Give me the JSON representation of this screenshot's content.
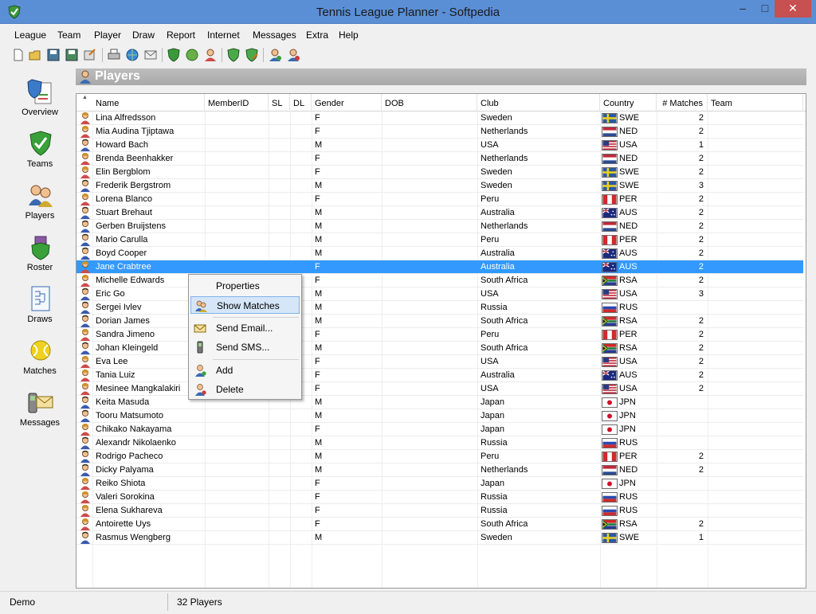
{
  "window": {
    "title": "Tennis League Planner - Softpedia"
  },
  "menu": [
    "League",
    "Team",
    "Player",
    "Draw",
    "Report",
    "Internet",
    "Messages",
    "Extra",
    "Help"
  ],
  "toolbar_icons": [
    "new-icon",
    "open-icon",
    "save-icon",
    "save-as-icon",
    "export-icon",
    "print-icon",
    "web-icon",
    "email-icon",
    "shield-check-icon",
    "globe-icon",
    "player-icon",
    "team-check-icon",
    "team-edit-icon",
    "add-player-icon",
    "delete-player-icon"
  ],
  "nav": [
    {
      "label": "Overview",
      "icon": "overview-icon"
    },
    {
      "label": "Teams",
      "icon": "teams-icon"
    },
    {
      "label": "Players",
      "icon": "players-icon"
    },
    {
      "label": "Roster",
      "icon": "roster-icon"
    },
    {
      "label": "Draws",
      "icon": "draws-icon"
    },
    {
      "label": "Matches",
      "icon": "matches-icon"
    },
    {
      "label": "Messages",
      "icon": "messages-icon"
    }
  ],
  "section": {
    "title": "Players"
  },
  "columns": [
    "Name",
    "MemberID",
    "SL",
    "DL",
    "Gender",
    "DOB",
    "Club",
    "Country",
    "# Matches",
    "Team"
  ],
  "selected_row": 11,
  "players": [
    {
      "name": "Lina Alfredsson",
      "gender": "F",
      "club": "Sweden",
      "country": "SWE",
      "matches": "2"
    },
    {
      "name": "Mia Audina Tjiptawa",
      "gender": "F",
      "club": "Netherlands",
      "country": "NED",
      "matches": "2"
    },
    {
      "name": "Howard Bach",
      "gender": "M",
      "club": "USA",
      "country": "USA",
      "matches": "1"
    },
    {
      "name": "Brenda Beenhakker",
      "gender": "F",
      "club": "Netherlands",
      "country": "NED",
      "matches": "2"
    },
    {
      "name": "Elin Bergblom",
      "gender": "F",
      "club": "Sweden",
      "country": "SWE",
      "matches": "2"
    },
    {
      "name": "Frederik Bergstrom",
      "gender": "M",
      "club": "Sweden",
      "country": "SWE",
      "matches": "3"
    },
    {
      "name": "Lorena Blanco",
      "gender": "F",
      "club": "Peru",
      "country": "PER",
      "matches": "2"
    },
    {
      "name": "Stuart Brehaut",
      "gender": "M",
      "club": "Australia",
      "country": "AUS",
      "matches": "2"
    },
    {
      "name": "Gerben Bruijstens",
      "gender": "M",
      "club": "Netherlands",
      "country": "NED",
      "matches": "2"
    },
    {
      "name": "Mario Carulla",
      "gender": "M",
      "club": "Peru",
      "country": "PER",
      "matches": "2"
    },
    {
      "name": "Boyd Cooper",
      "gender": "M",
      "club": "Australia",
      "country": "AUS",
      "matches": "2"
    },
    {
      "name": "Jane Crabtree",
      "gender": "F",
      "club": "Australia",
      "country": "AUS",
      "matches": "2"
    },
    {
      "name": "Michelle Edwards",
      "gender": "F",
      "club": "South Africa",
      "country": "RSA",
      "matches": "2"
    },
    {
      "name": "Eric Go",
      "gender": "M",
      "club": "USA",
      "country": "USA",
      "matches": "3"
    },
    {
      "name": "Sergei Ivlev",
      "gender": "M",
      "club": "Russia",
      "country": "RUS",
      "matches": ""
    },
    {
      "name": "Dorian James",
      "gender": "M",
      "club": "South Africa",
      "country": "RSA",
      "matches": "2"
    },
    {
      "name": "Sandra Jimeno",
      "gender": "F",
      "club": "Peru",
      "country": "PER",
      "matches": "2"
    },
    {
      "name": "Johan Kleingeld",
      "gender": "M",
      "club": "South Africa",
      "country": "RSA",
      "matches": "2"
    },
    {
      "name": "Eva Lee",
      "gender": "F",
      "club": "USA",
      "country": "USA",
      "matches": "2"
    },
    {
      "name": "Tania Luiz",
      "gender": "F",
      "club": "Australia",
      "country": "AUS",
      "matches": "2"
    },
    {
      "name": "Mesinee Mangkalakiri",
      "gender": "F",
      "club": "USA",
      "country": "USA",
      "matches": "2"
    },
    {
      "name": "Keita Masuda",
      "gender": "M",
      "club": "Japan",
      "country": "JPN",
      "matches": ""
    },
    {
      "name": "Tooru Matsumoto",
      "gender": "M",
      "club": "Japan",
      "country": "JPN",
      "matches": ""
    },
    {
      "name": "Chikako Nakayama",
      "gender": "F",
      "club": "Japan",
      "country": "JPN",
      "matches": ""
    },
    {
      "name": "Alexandr Nikolaenko",
      "gender": "M",
      "club": "Russia",
      "country": "RUS",
      "matches": ""
    },
    {
      "name": "Rodrigo Pacheco",
      "gender": "M",
      "club": "Peru",
      "country": "PER",
      "matches": "2"
    },
    {
      "name": "Dicky Palyama",
      "gender": "M",
      "club": "Netherlands",
      "country": "NED",
      "matches": "2"
    },
    {
      "name": "Reiko Shiota",
      "gender": "F",
      "club": "Japan",
      "country": "JPN",
      "matches": ""
    },
    {
      "name": "Valeri Sorokina",
      "gender": "F",
      "club": "Russia",
      "country": "RUS",
      "matches": ""
    },
    {
      "name": "Elena Sukhareva",
      "gender": "F",
      "club": "Russia",
      "country": "RUS",
      "matches": ""
    },
    {
      "name": "Antoirette Uys",
      "gender": "F",
      "club": "South Africa",
      "country": "RSA",
      "matches": "2"
    },
    {
      "name": "Rasmus Wengberg",
      "gender": "M",
      "club": "Sweden",
      "country": "SWE",
      "matches": "1"
    }
  ],
  "context_menu": [
    {
      "label": "Properties",
      "icon": "none",
      "highlight": false
    },
    {
      "label": "Show Matches",
      "icon": "players-icon",
      "highlight": true
    },
    {
      "sep": true
    },
    {
      "label": "Send Email...",
      "icon": "email-icon",
      "highlight": false
    },
    {
      "label": "Send SMS...",
      "icon": "phone-icon",
      "highlight": false
    },
    {
      "sep": true
    },
    {
      "label": "Add",
      "icon": "add-player-icon",
      "highlight": false
    },
    {
      "label": "Delete",
      "icon": "delete-player-icon",
      "highlight": false
    }
  ],
  "status": {
    "left": "Demo",
    "right": "32 Players"
  },
  "colors": {
    "selection": "#3399ff",
    "titlebar": "#5a8fd6",
    "close": "#c75050",
    "section_header": "#b0b0b0"
  }
}
